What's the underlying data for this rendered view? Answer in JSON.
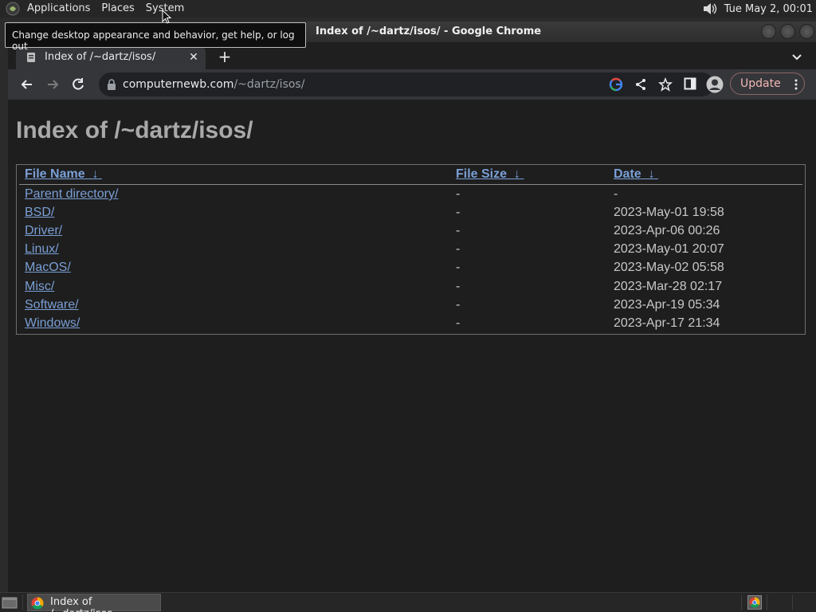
{
  "top_panel": {
    "menus": [
      "Applications",
      "Places",
      "System"
    ],
    "clock": "Tue May  2, 00:01",
    "tooltip": "Change desktop appearance and behavior, get help, or log out"
  },
  "window": {
    "title": "Index of /~dartz/isos/ - Google Chrome"
  },
  "browser": {
    "tab_title": "Index of /~dartz/isos/",
    "url_host": "computernewb.com",
    "url_path": "/~dartz/isos/",
    "update_label": "Update"
  },
  "page": {
    "heading": "Index of /~dartz/isos/",
    "columns": {
      "name": "File Name",
      "size": "File Size",
      "date": "Date",
      "sort_arrow": "↓"
    },
    "rows": [
      {
        "name": "Parent directory/",
        "size": "-",
        "date": "-"
      },
      {
        "name": "BSD/",
        "size": "-",
        "date": "2023-May-01 19:58"
      },
      {
        "name": "Driver/",
        "size": "-",
        "date": "2023-Apr-06 00:26"
      },
      {
        "name": "Linux/",
        "size": "-",
        "date": "2023-May-01 20:07"
      },
      {
        "name": "MacOS/",
        "size": "-",
        "date": "2023-May-02 05:58"
      },
      {
        "name": "Misc/",
        "size": "-",
        "date": "2023-Mar-28 02:17"
      },
      {
        "name": "Software/",
        "size": "-",
        "date": "2023-Apr-19 05:34"
      },
      {
        "name": "Windows/",
        "size": "-",
        "date": "2023-Apr-17 21:34"
      }
    ]
  },
  "taskbar": {
    "task_label": "Index of /~dartz/isos..."
  },
  "colors": {
    "link": "#7a9fd6",
    "update_text": "#f2b8b5",
    "page_bg": "#1e1e1e"
  }
}
